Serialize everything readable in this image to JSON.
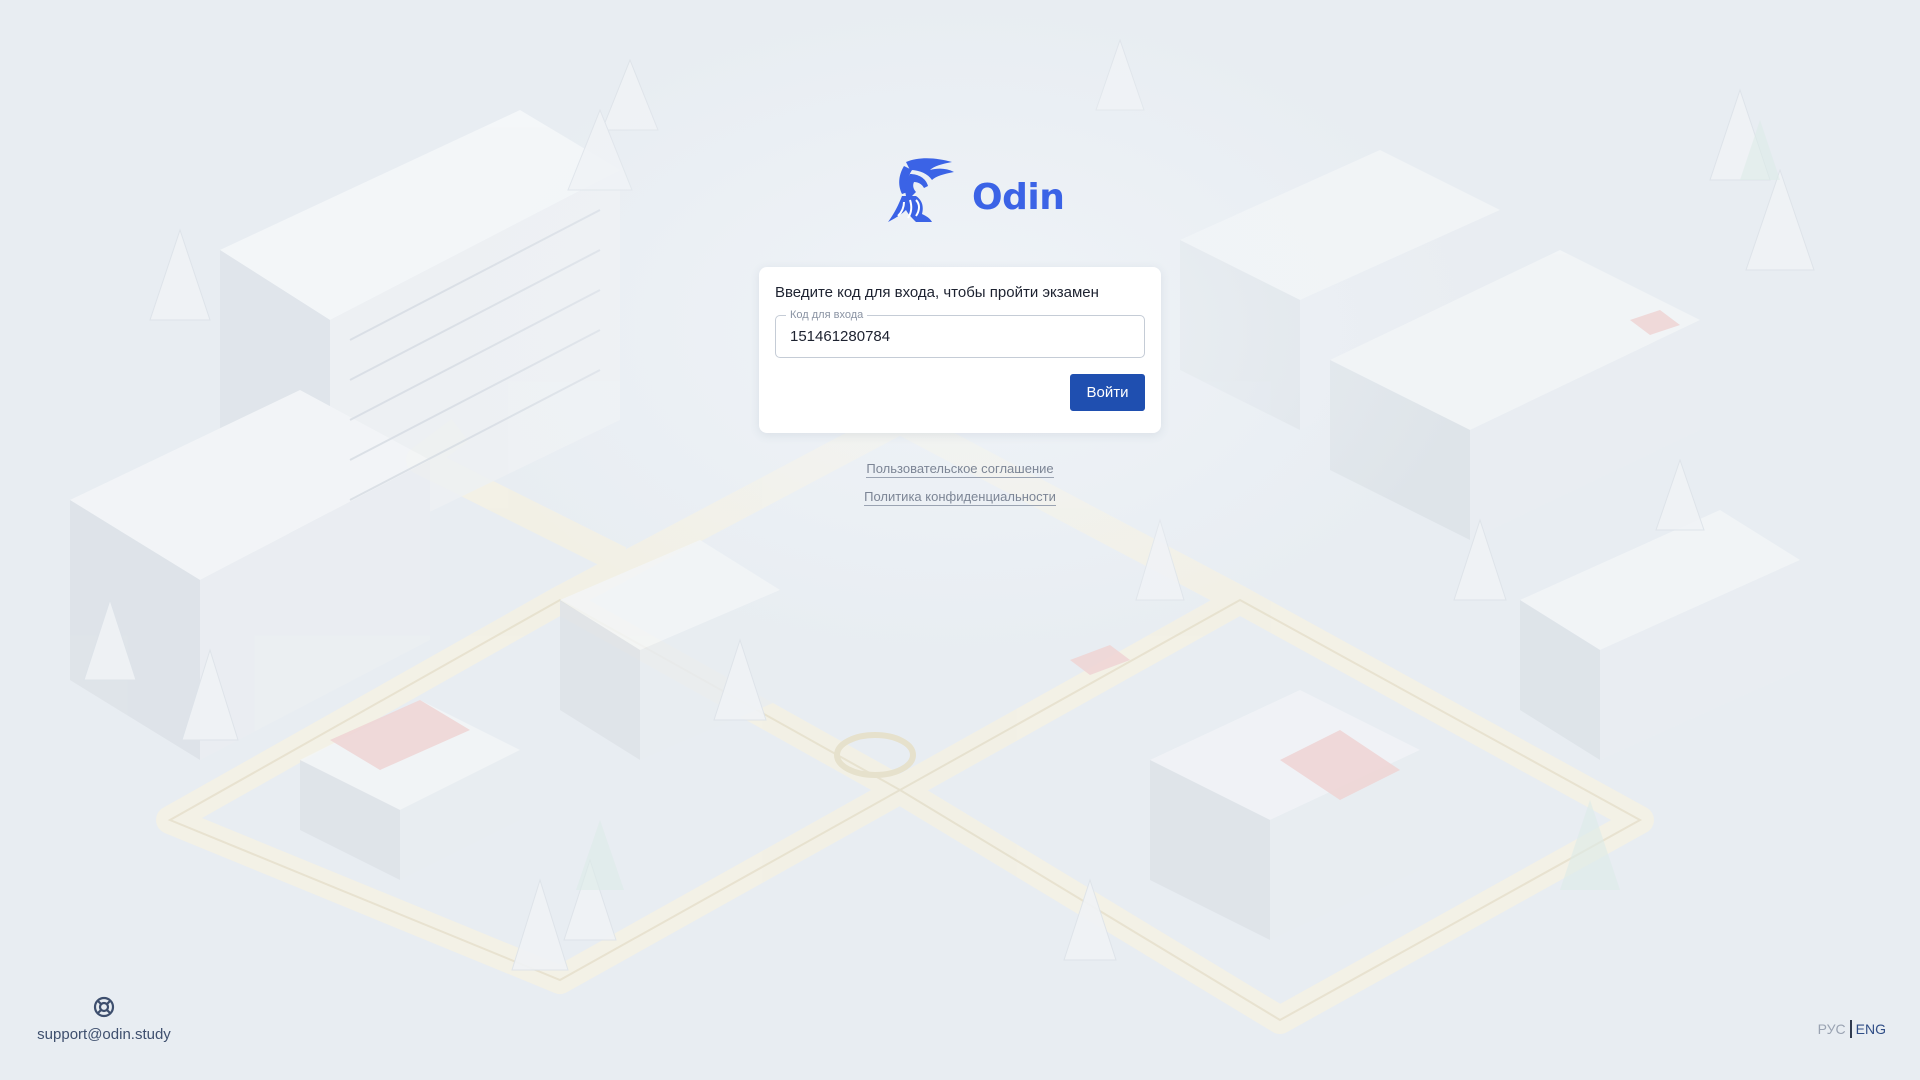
{
  "brand": {
    "name": "Odin",
    "color": "#3b63e6"
  },
  "login": {
    "title": "Введите код для входа, чтобы пройти экзамен",
    "code_label": "Код для входа",
    "code_value": "151461280784",
    "submit_label": "Войти",
    "button_color": "#1f4fb0"
  },
  "legal": {
    "user_agreement": "Пользовательское соглашение",
    "privacy_policy": "Политика конфиденциальности"
  },
  "support": {
    "icon": "lifebuoy-icon",
    "email": "support@odin.study"
  },
  "language": {
    "ru": "РУС",
    "en": "ENG",
    "active": "ENG"
  },
  "background": {
    "description_icon": "isometric-city-illustration"
  }
}
